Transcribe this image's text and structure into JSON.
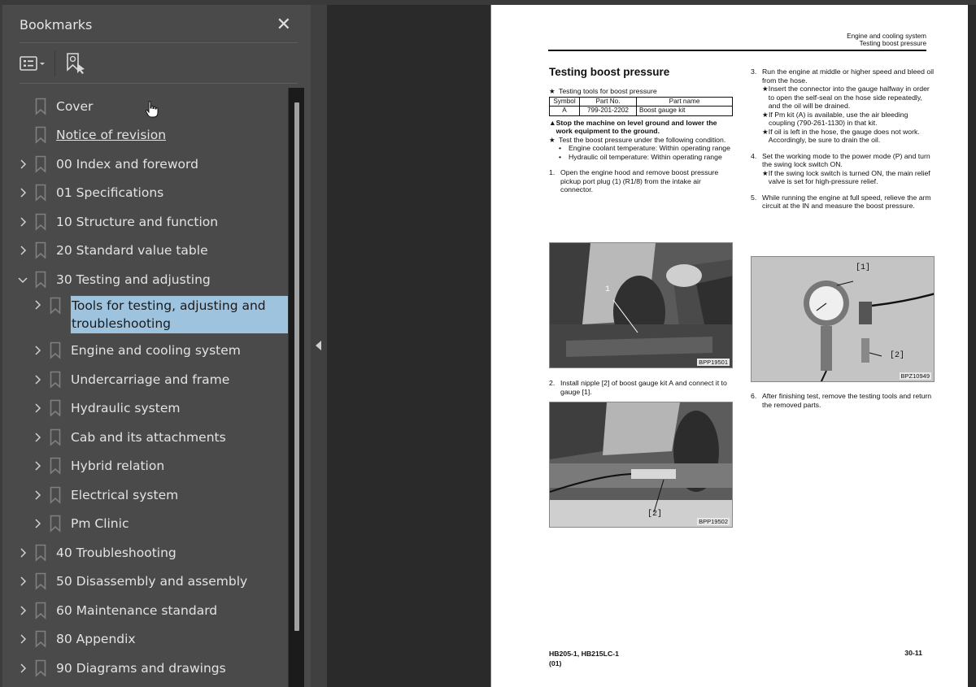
{
  "sidebar": {
    "title": "Bookmarks",
    "close_icon": "close-icon",
    "tools": {
      "options_icon": "list-options-icon",
      "find_bookmark_icon": "find-current-bookmark-icon"
    },
    "items": [
      {
        "label": "Cover",
        "level": 0,
        "expandable": false
      },
      {
        "label": "Notice of revision",
        "level": 0,
        "expandable": false,
        "underlined": true
      },
      {
        "label": "00 Index and foreword",
        "level": 0,
        "expandable": true,
        "expanded": false
      },
      {
        "label": "01 Specifications",
        "level": 0,
        "expandable": true,
        "expanded": false
      },
      {
        "label": "10 Structure and function",
        "level": 0,
        "expandable": true,
        "expanded": false
      },
      {
        "label": "20 Standard value table",
        "level": 0,
        "expandable": true,
        "expanded": false
      },
      {
        "label": "30 Testing and adjusting",
        "level": 0,
        "expandable": true,
        "expanded": true
      },
      {
        "label": "Tools for testing, adjusting and troubleshooting",
        "level": 1,
        "expandable": true,
        "expanded": false,
        "selected": true
      },
      {
        "label": "Engine and cooling system",
        "level": 1,
        "expandable": true,
        "expanded": false
      },
      {
        "label": "Undercarriage and frame",
        "level": 1,
        "expandable": true,
        "expanded": false
      },
      {
        "label": "Hydraulic system",
        "level": 1,
        "expandable": true,
        "expanded": false
      },
      {
        "label": "Cab and its attachments",
        "level": 1,
        "expandable": true,
        "expanded": false
      },
      {
        "label": "Hybrid relation",
        "level": 1,
        "expandable": true,
        "expanded": false
      },
      {
        "label": "Electrical system",
        "level": 1,
        "expandable": true,
        "expanded": false
      },
      {
        "label": "Pm Clinic",
        "level": 1,
        "expandable": true,
        "expanded": false
      },
      {
        "label": "40 Troubleshooting",
        "level": 0,
        "expandable": true,
        "expanded": false
      },
      {
        "label": "50 Disassembly and assembly",
        "level": 0,
        "expandable": true,
        "expanded": false
      },
      {
        "label": "60 Maintenance standard",
        "level": 0,
        "expandable": true,
        "expanded": false
      },
      {
        "label": "80 Appendix",
        "level": 0,
        "expandable": true,
        "expanded": false
      },
      {
        "label": "90 Diagrams and drawings",
        "level": 0,
        "expandable": true,
        "expanded": false
      }
    ]
  },
  "document": {
    "header": {
      "section": "Engine and cooling system",
      "subsection": "Testing boost pressure"
    },
    "title": "Testing boost pressure",
    "tools_note": "Testing tools for boost pressure",
    "table": {
      "headers": [
        "Symbol",
        "Part No.",
        "Part name"
      ],
      "rows": [
        [
          "A",
          "799-201-2202",
          "Boost gauge kit"
        ]
      ]
    },
    "warning": "Stop the machine on level ground and lower the work equipment to the ground.",
    "condition_note": "Test the boost pressure under the following condition.",
    "conditions": [
      "Engine coolant temperature: Within operating range",
      "Hydraulic oil temperature: Within operating range"
    ],
    "steps": [
      {
        "num": "1.",
        "text": "Open the engine hood and remove boost pressure pickup port plug (1) (R1/8) from the intake air connector."
      },
      {
        "num": "2.",
        "text": "Install nipple [2] of boost gauge kit A and connect it to gauge [1]."
      },
      {
        "num": "3.",
        "text": "Run the engine at middle or higher speed and bleed oil from the hose.",
        "notes": [
          "Insert the connector into the gauge halfway in order to open the self-seal on the hose side repeatedly, and the oil will be drained.",
          "If Pm kit (A) is available, use the air bleeding coupling (790-261-1130) in that kit.",
          "If oil is left in the hose, the gauge does not work. Accordingly, be sure to drain the oil."
        ]
      },
      {
        "num": "4.",
        "text": "Set the working mode to the power mode (P) and turn the swing lock switch ON.",
        "notes": [
          "If the swing lock switch is turned ON, the main relief valve is set for high-pressure relief."
        ]
      },
      {
        "num": "5.",
        "text": "While running the engine at full speed, relieve the arm circuit at the IN and measure the boost pressure."
      },
      {
        "num": "6.",
        "text": "After finishing test, remove the testing tools and return the removed parts."
      }
    ],
    "figures": [
      {
        "code": "BPP19501",
        "callouts": [
          "1"
        ]
      },
      {
        "code": "BPP19502",
        "callouts": [
          "[2]"
        ]
      },
      {
        "code": "BPZ10949",
        "callouts": [
          "[1]",
          "[2]"
        ]
      }
    ],
    "footer": {
      "model": "HB205-1, HB215LC-1",
      "revision": "(01)",
      "page": "30-11"
    }
  }
}
